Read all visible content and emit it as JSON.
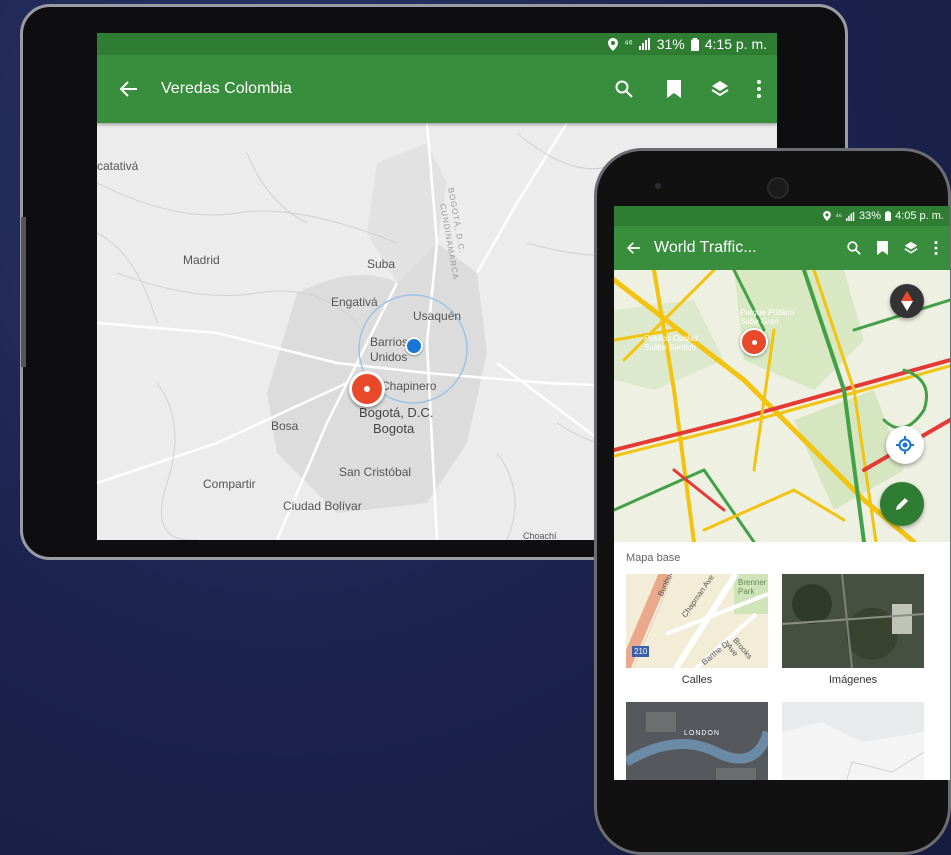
{
  "tablet": {
    "status": {
      "network": "⁴⁶",
      "battery": "31%",
      "time": "4:15 p. m."
    },
    "appbar": {
      "title": "Veredas Colombia",
      "back_icon": "arrow-left-icon",
      "actions": [
        "search-icon",
        "bookmark-icon",
        "layers-icon",
        "more-vert-icon"
      ]
    },
    "map_labels": {
      "facatativa": "catativá",
      "madrid": "Madrid",
      "suba": "Suba",
      "engativa": "Engativá",
      "usaquen": "Usaquén",
      "barrios_unidos": "Barrios\nUnidos",
      "chapinero": "Chapinero",
      "bogota_dc": "Bogotá, D.C.",
      "bogota": "Bogota",
      "bosa": "Bosa",
      "san_cristobal": "San Cristóbal",
      "compartir": "Compartir",
      "ciudad_bolivar": "Ciudad Bolívar",
      "choachi": "Choachí",
      "cundinamarca": "CUNDINAMARCA",
      "bogota_dc_vertical": "BOGOTÁ, D.C."
    }
  },
  "phone": {
    "status": {
      "network": "⁴⁶",
      "battery": "33%",
      "time": "4:05 p. m."
    },
    "appbar": {
      "title": "World Traffic...",
      "back_icon": "arrow-left-icon",
      "actions": [
        "search-icon",
        "bookmark-icon",
        "layers-icon",
        "more-vert-icon"
      ]
    },
    "map_labels": {
      "park1": "Parque Público\nSuba Gran",
      "park2": "Público Ciudad\nSalitre Sentido"
    },
    "basemap": {
      "title": "Mapa base",
      "items": [
        {
          "label": "Calles",
          "street1": "Bunbury Ave",
          "street2": "Chapman Ave",
          "street3": "Brenner Park",
          "street4": "Barthe Dr",
          "street5": "Brooks Ave",
          "shield": "210"
        },
        {
          "label": "Imágenes"
        },
        {
          "label": "",
          "city": "LONDON"
        },
        {
          "label": ""
        }
      ]
    }
  },
  "colors": {
    "appbar": "#388e3c",
    "statusbar": "#2e7d32",
    "pin": "#e8492a",
    "location": "#1976d2",
    "fab_edit": "#2e7d32"
  }
}
